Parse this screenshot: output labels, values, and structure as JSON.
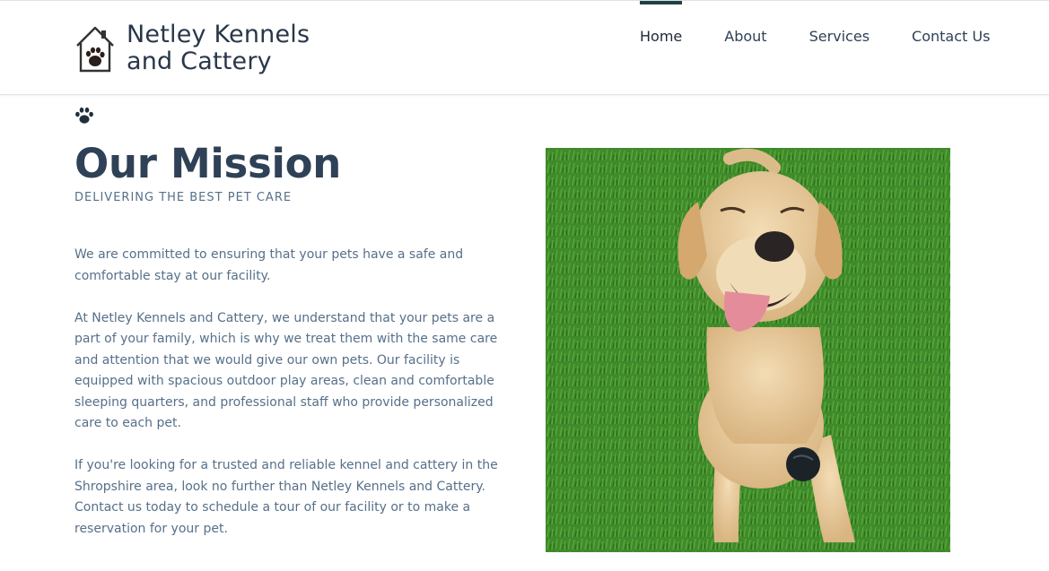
{
  "brand": {
    "line1": "Netley Kennels",
    "line2": "and Cattery",
    "logo_icon": "house-paw-icon"
  },
  "nav": {
    "items": [
      {
        "label": "Home",
        "active": true
      },
      {
        "label": "About",
        "active": false
      },
      {
        "label": "Services",
        "active": false
      },
      {
        "label": "Contact Us",
        "active": false
      }
    ]
  },
  "mission": {
    "icon": "paw-icon",
    "title": "Our Mission",
    "subtitle": "DELIVERING THE BEST PET CARE",
    "paragraphs": [
      "We are committed to ensuring that your pets have a safe and comfortable stay at our facility.",
      "At Netley Kennels and Cattery, we understand that your pets are a part of your family, which is why we treat them with the same care and attention that we would give our own pets. Our facility is equipped with spacious outdoor play areas, clean and comfortable sleeping quarters, and professional staff who provide personalized care to each pet.",
      "If you're looking for a trusted and reliable kennel and cattery in the Shropshire area, look no further than Netley Kennels and Cattery. Contact us today to schedule a tour of our facility or to make a reservation for your pet."
    ]
  },
  "photo": {
    "subject": "labrador-on-grass"
  },
  "colors": {
    "heading": "#2f4156",
    "body": "#567089",
    "nav_active_bar": "#1f4045"
  }
}
